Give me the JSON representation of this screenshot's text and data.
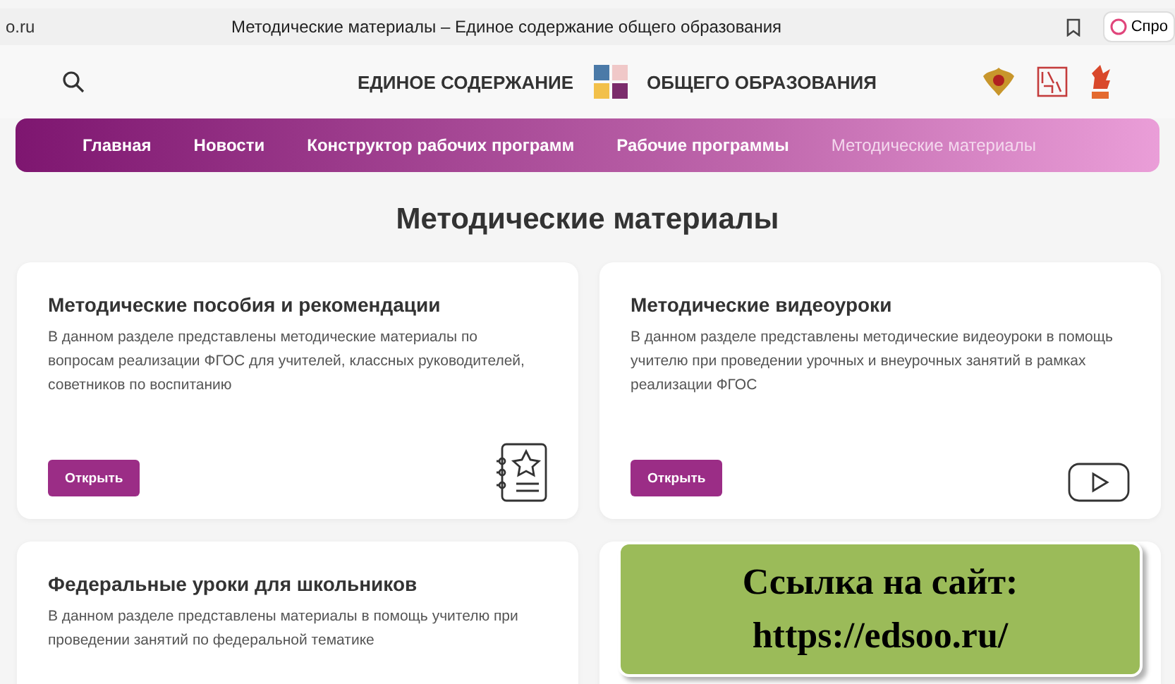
{
  "browser": {
    "address": "o.ru",
    "tab_title": "Методические материалы – Единое содержание общего образования",
    "side_button": "Спро"
  },
  "header": {
    "title_left": "ЕДИНОЕ СОДЕРЖАНИЕ",
    "title_right": "ОБЩЕГО ОБРАЗОВАНИЯ"
  },
  "nav": [
    {
      "label": "Главная",
      "selected": false
    },
    {
      "label": "Новости",
      "selected": false
    },
    {
      "label": "Конструктор рабочих программ",
      "selected": false
    },
    {
      "label": "Рабочие программы",
      "selected": false
    },
    {
      "label": "Методические материалы",
      "selected": true
    }
  ],
  "page_title": "Методические материалы",
  "cards": [
    {
      "title": "Методические пособия и рекомендации",
      "text": "В данном разделе представлены методические материалы по вопросам реализации ФГОС для учителей, классных руководителей, советников по воспитанию",
      "button": "Открыть",
      "kind": "notebook"
    },
    {
      "title": "Методические видеоуроки",
      "text": "В данном разделе представлены методические видеоуроки в помощь учителю при проведении урочных и внеурочных занятий в рамках реализации ФГОС",
      "button": "Открыть",
      "kind": "video"
    },
    {
      "title": "Федеральные уроки для школьников",
      "text": "В данном разделе представлены материалы в помощь учителю при проведении занятий по федеральной тематике"
    }
  ],
  "callout": {
    "line_1": "Ссылка на сайт:",
    "line_2": "https://edsoo.ru/"
  }
}
